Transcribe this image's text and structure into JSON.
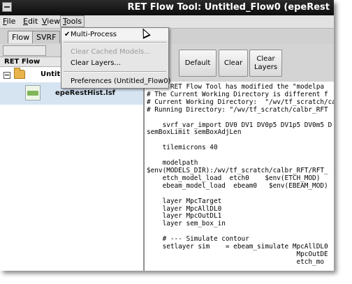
{
  "window": {
    "title": "RET Flow Tool: Untitled_Flow0 (epeRest"
  },
  "menubar": {
    "file": "File",
    "file_rest": "ile",
    "edit": "E",
    "edit_rest": "dit",
    "view": "V",
    "view_rest": "iew",
    "tools": "T",
    "tools_rest": "ools"
  },
  "tabs": [
    {
      "label": "Flow"
    },
    {
      "label": "SVRF"
    }
  ],
  "tree": {
    "header": "RET Flow",
    "root_label": "Untitled",
    "child_label": "epeRestHist.lsf"
  },
  "toolbar": {
    "default_label": "Default",
    "clear_label": "Clear",
    "clear_layers_label": "Clear\nLayers"
  },
  "tools_menu": {
    "multiprocess": "Multi-Process",
    "multiprocess_checked": true,
    "clear_cached": "Clear Cached Models...",
    "clear_layers": "Clear Layers...",
    "preferences": "Preferences (Untitled_Flow0)"
  },
  "editor": {
    "lines": [
      "# The RET Flow Tool has modified the \"modelpa",
      "# The Current Working Directory is different f",
      "# Current Working Directory:  \"/wv/tf_scratch/ca",
      "# Running Directory: \"/wv/tf_scratch/calbr_RFT",
      "",
      "    svrf_var_import DV0 DV1 DV0p5 DV1p5 DV0m5 D",
      "semBoxLimit semBoxAdjLen",
      "",
      "    tilemicrons 40",
      "",
      "    modelpath",
      "$env(MODELS_DIR):/wv/tf_scratch/calbr_RFT/RFT_",
      "    etch_model_load  etch0    $env(ETCH_MOD)",
      "    ebeam_model_load  ebeam0   $env(EBEAM_MOD)",
      "",
      "    layer MpcTarget",
      "    layer MpcAllDL0",
      "    layer MpcOutDL1",
      "    layer sem_box_in",
      "",
      "    # --- Simulate contour",
      "    setlayer sim    = ebeam_simulate MpcAllDL0",
      "                                      MpcOutDE",
      "                                      etch_mo"
    ]
  }
}
